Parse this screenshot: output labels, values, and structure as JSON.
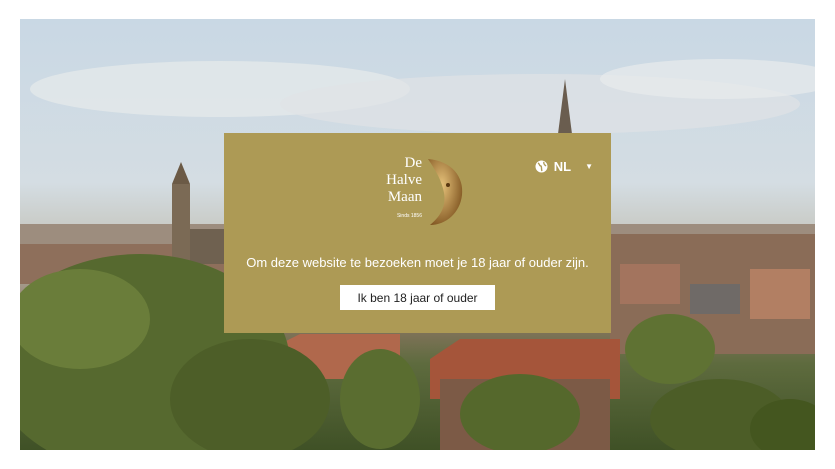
{
  "brand": {
    "logo_lines": [
      "De",
      "Halve",
      "Maan"
    ],
    "logo_tagline": "Sinds 1856"
  },
  "language": {
    "icon": "globe-icon",
    "selected": "NL"
  },
  "age_gate": {
    "message": "Om deze website te bezoeken moet je 18 jaar of ouder zijn.",
    "confirm_label": "Ik ben 18 jaar of ouder"
  },
  "colors": {
    "modal_bg": "#ad9a55",
    "button_bg": "#ffffff"
  }
}
